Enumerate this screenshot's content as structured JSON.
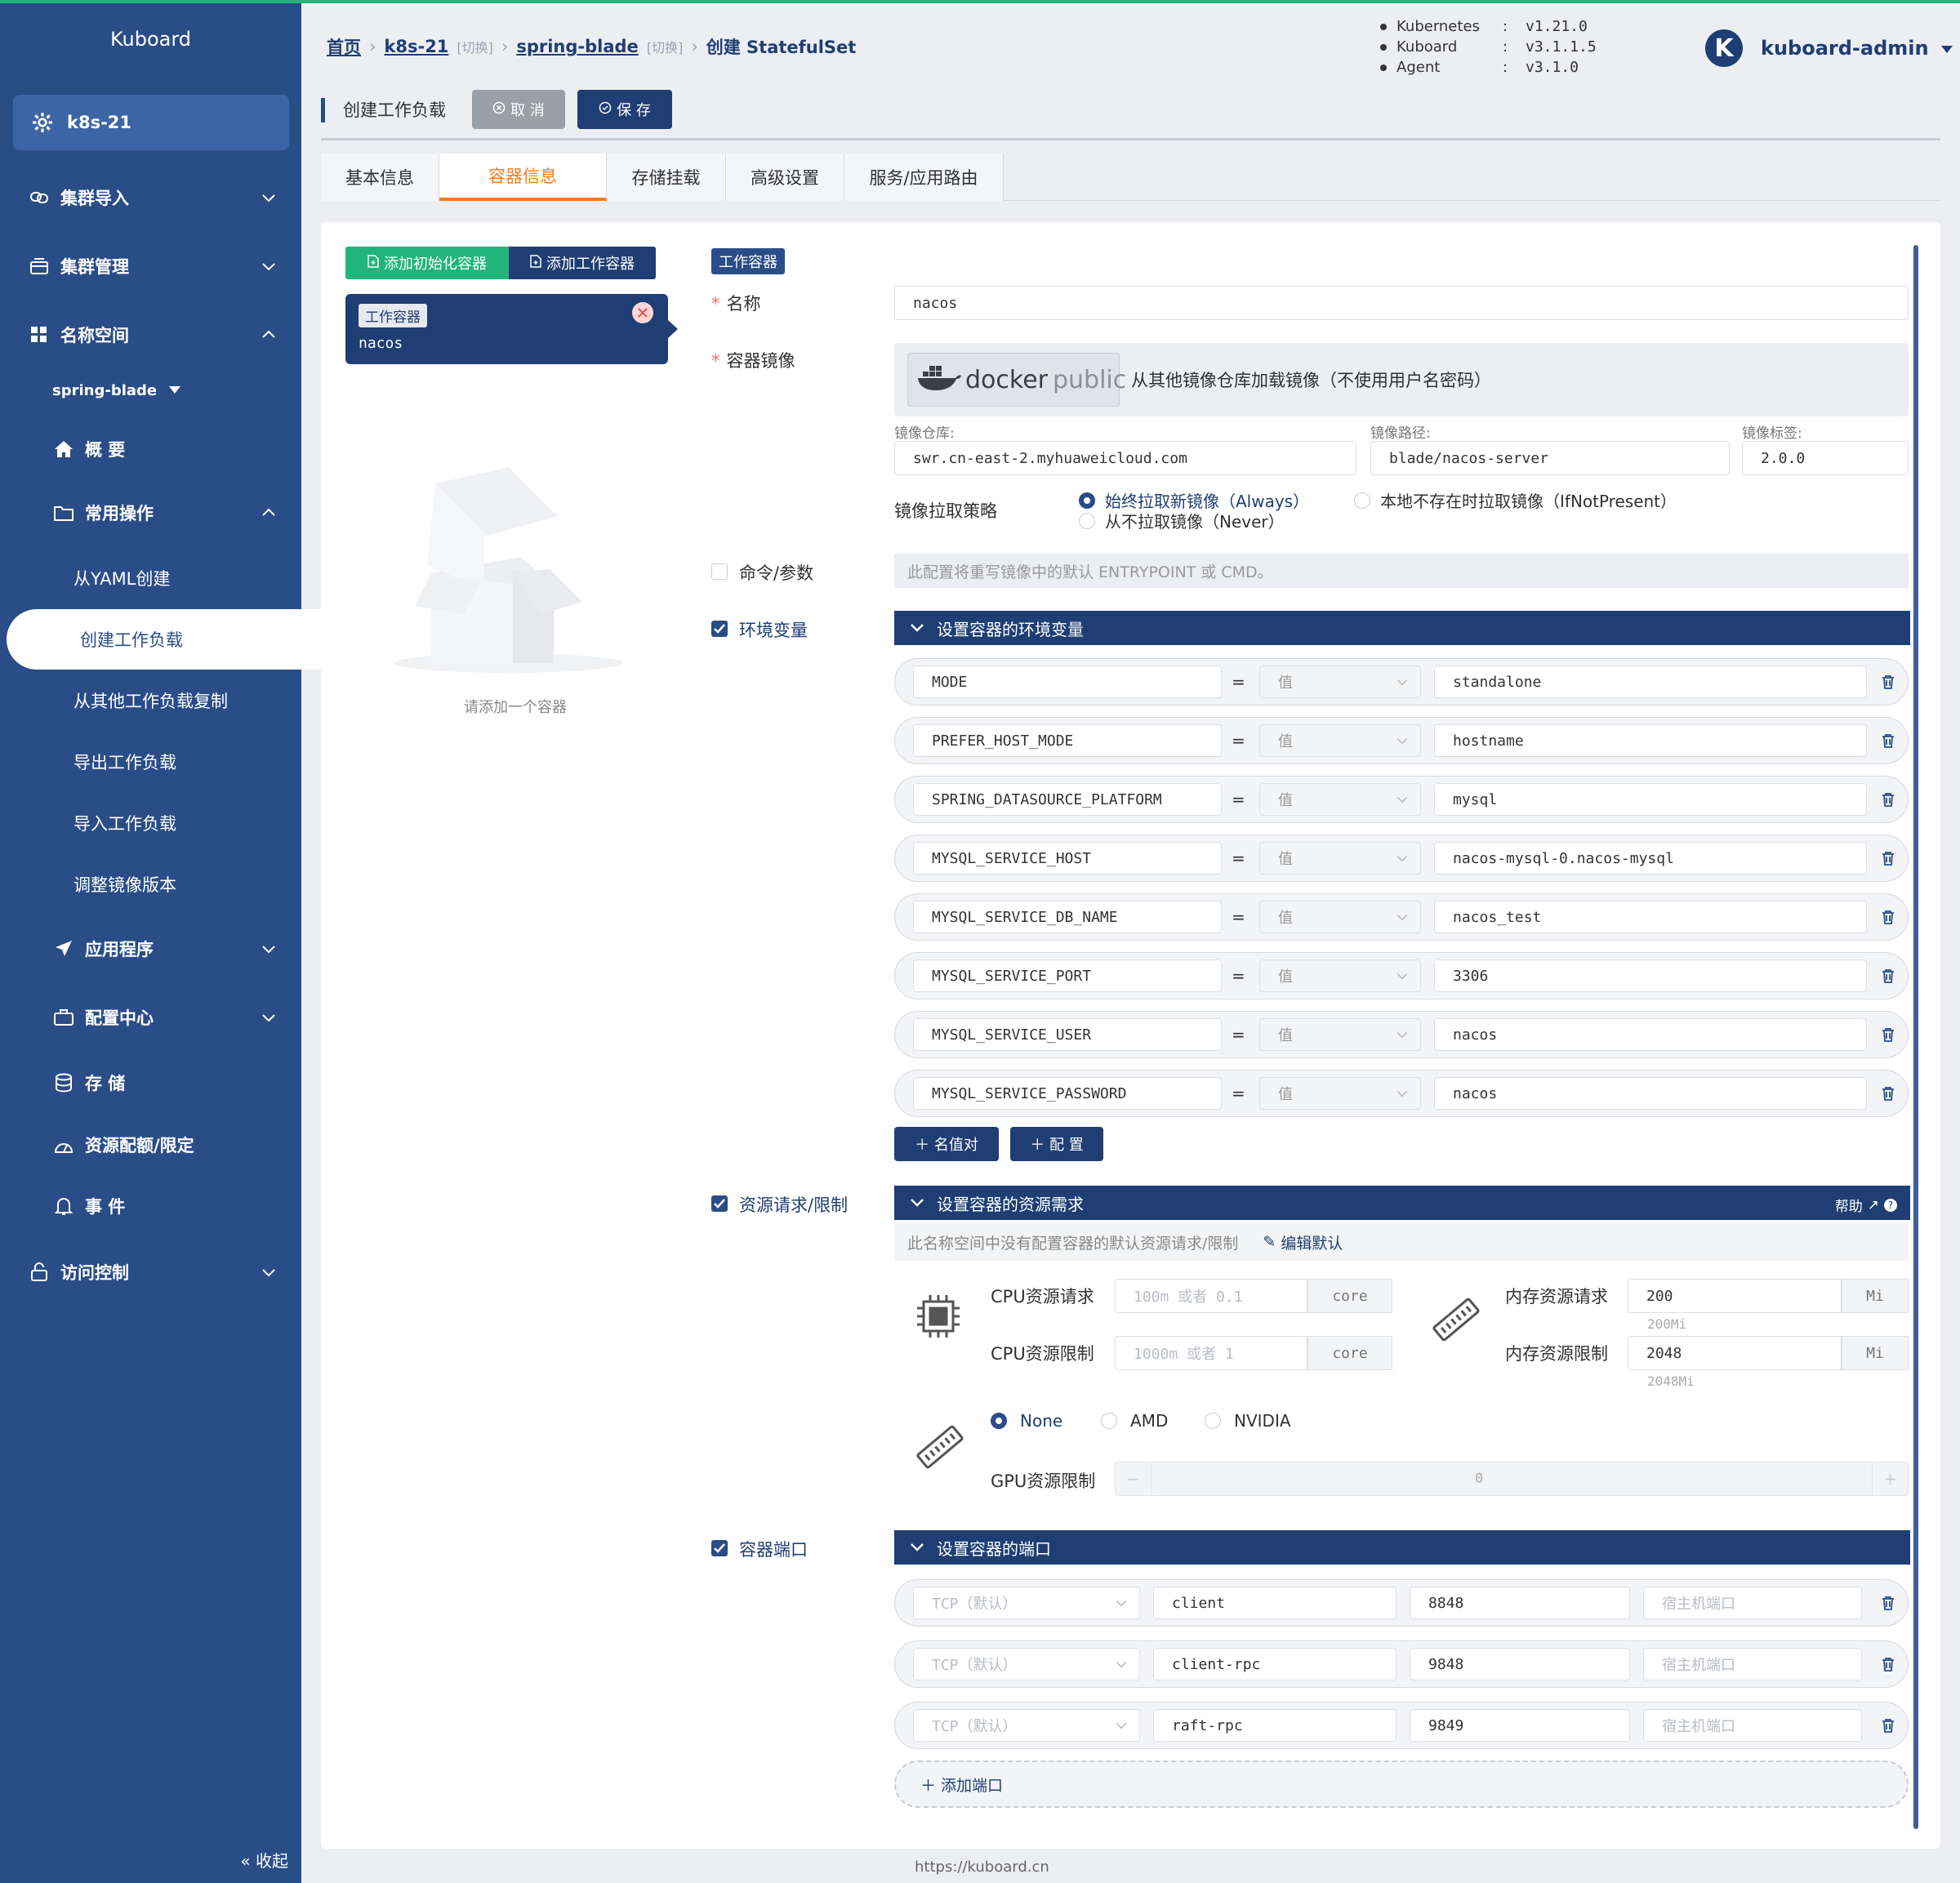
{
  "sidebar": {
    "brand": "Kuboard",
    "cluster": "k8s-21",
    "menu": {
      "import": "集群导入",
      "manage": "集群管理",
      "namespace": "名称空间",
      "ns_name": "spring-blade",
      "overview": "概 要",
      "common_ops": "常用操作",
      "from_yaml": "从YAML创建",
      "create_workload": "创建工作负载",
      "copy_workload": "从其他工作负载复制",
      "export_workload": "导出工作负载",
      "import_workload": "导入工作负载",
      "adjust_image": "调整镜像版本",
      "apps": "应用程序",
      "config": "配置中心",
      "storage": "存 储",
      "quota": "资源配额/限定",
      "events": "事 件",
      "access": "访问控制"
    },
    "collapse": "« 收起"
  },
  "breadcrumb": {
    "home": "首页",
    "cluster": "k8s-21",
    "switch1": "[切换]",
    "namespace": "spring-blade",
    "switch2": "[切换]",
    "current": "创建 StatefulSet"
  },
  "versions": [
    {
      "name": "Kubernetes",
      "value": "v1.21.0"
    },
    {
      "name": "Kuboard",
      "value": "v3.1.1.5"
    },
    {
      "name": "Agent",
      "value": "v3.1.0"
    }
  ],
  "user": {
    "initial": "K",
    "name": "kuboard-admin"
  },
  "toolbar": {
    "title": "创建工作负载",
    "cancel": "取 消",
    "save": "保 存"
  },
  "tabs": [
    "基本信息",
    "容器信息",
    "存储挂载",
    "高级设置",
    "服务/应用路由"
  ],
  "containers": {
    "add_init": "添加初始化容器",
    "add_work": "添加工作容器",
    "card_tag": "工作容器",
    "card_name": "nacos",
    "empty_hint": "请添加一个容器"
  },
  "form": {
    "tag": "工作容器",
    "name_label": "名称",
    "name_value": "nacos",
    "image_label": "容器镜像",
    "docker_logo": "docker",
    "docker_public": "public",
    "image_source": "从其他镜像仓库加载镜像（不使用用户名密码）",
    "registry_label": "镜像仓库:",
    "registry_value": "swr.cn-east-2.myhuaweicloud.com",
    "path_label": "镜像路径:",
    "path_value": "blade/nacos-server",
    "tag_label": "镜像标签:",
    "tag_value": "2.0.0",
    "pull_label": "镜像拉取策略",
    "pull_always": "始终拉取新镜像（Always）",
    "pull_ifnotpresent": "本地不存在时拉取镜像（IfNotPresent）",
    "pull_never": "从不拉取镜像（Never）",
    "cmd_label": "命令/参数",
    "cmd_hint": "此配置将重写镜像中的默认 ENTRYPOINT 或 CMD。",
    "env_label": "环境变量",
    "env_bar": "设置容器的环境变量",
    "env_type": "值",
    "env": [
      {
        "key": "MODE",
        "value": "standalone"
      },
      {
        "key": "PREFER_HOST_MODE",
        "value": "hostname"
      },
      {
        "key": "SPRING_DATASOURCE_PLATFORM",
        "value": "mysql"
      },
      {
        "key": "MYSQL_SERVICE_HOST",
        "value": "nacos-mysql-0.nacos-mysql"
      },
      {
        "key": "MYSQL_SERVICE_DB_NAME",
        "value": "nacos_test"
      },
      {
        "key": "MYSQL_SERVICE_PORT",
        "value": "3306"
      },
      {
        "key": "MYSQL_SERVICE_USER",
        "value": "nacos"
      },
      {
        "key": "MYSQL_SERVICE_PASSWORD",
        "value": "nacos"
      }
    ],
    "add_kv": "名值对",
    "add_cfg": "配 置",
    "res_label": "资源请求/限制",
    "res_bar": "设置容器的资源需求",
    "help": "帮助",
    "res_hint": "此名称空间中没有配置容器的默认资源请求/限制",
    "edit_default": "编辑默认",
    "cpu_req_label": "CPU资源请求",
    "cpu_req_ph": "100m 或者 0.1",
    "cpu_lim_label": "CPU资源限制",
    "cpu_lim_ph": "1000m 或者 1",
    "core": "core",
    "mem_req_label": "内存资源请求",
    "mem_req_value": "200",
    "mem_req_hint": "200Mi",
    "mem_lim_label": "内存资源限制",
    "mem_lim_value": "2048",
    "mem_lim_hint": "2048Mi",
    "mi": "Mi",
    "gpu_none": "None",
    "gpu_amd": "AMD",
    "gpu_nvidia": "NVIDIA",
    "gpu_label": "GPU资源限制",
    "gpu_value": "0",
    "ports_label": "容器端口",
    "ports_bar": "设置容器的端口",
    "protocol_ph": "TCP（默认）",
    "host_port_ph": "宿主机端口",
    "ports": [
      {
        "name": "client",
        "port": "8848"
      },
      {
        "name": "client-rpc",
        "port": "9848"
      },
      {
        "name": "raft-rpc",
        "port": "9849"
      }
    ],
    "add_port": "添加端口"
  },
  "footer": "https://kuboard.cn",
  "colors": {
    "sidebar": "#2a4d88",
    "accent": "#21b47b",
    "tab_active": "#ff7a1a",
    "navy": "#1f3e73"
  }
}
